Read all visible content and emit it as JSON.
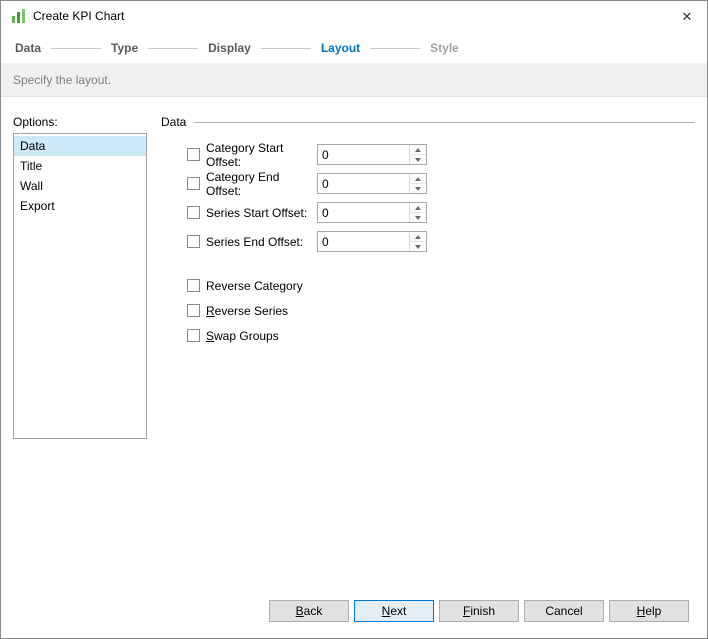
{
  "window": {
    "title": "Create KPI Chart",
    "close_glyph": "✕"
  },
  "steps": [
    {
      "label": "Data",
      "state": "done"
    },
    {
      "label": "Type",
      "state": "done"
    },
    {
      "label": "Display",
      "state": "done"
    },
    {
      "label": "Layout",
      "state": "active"
    },
    {
      "label": "Style",
      "state": "upcoming"
    }
  ],
  "subtitle": "Specify the layout.",
  "options": {
    "label": "Options:",
    "items": [
      {
        "label": "Data",
        "selected": true
      },
      {
        "label": "Title",
        "selected": false
      },
      {
        "label": "Wall",
        "selected": false
      },
      {
        "label": "Export",
        "selected": false
      }
    ]
  },
  "panel": {
    "header": "Data",
    "offset_fields": [
      {
        "label": "Category Start Offset:",
        "value": "0",
        "checked": false
      },
      {
        "label": "Category End Offset:",
        "value": "0",
        "checked": false
      },
      {
        "label": "Series Start Offset:",
        "value": "0",
        "checked": false
      },
      {
        "label": "Series End Offset:",
        "value": "0",
        "checked": false
      }
    ],
    "toggles": [
      {
        "label": "Reverse Category",
        "mnemonic": -1,
        "checked": false
      },
      {
        "label": "Reverse Series",
        "mnemonic": 0,
        "checked": false
      },
      {
        "label": "Swap Groups",
        "mnemonic": 0,
        "checked": false
      }
    ]
  },
  "footer": {
    "buttons": [
      {
        "label": "Back",
        "mnemonic": 0,
        "default": false
      },
      {
        "label": "Next",
        "mnemonic": 0,
        "default": true
      },
      {
        "label": "Finish",
        "mnemonic": 0,
        "default": false
      },
      {
        "label": "Cancel",
        "mnemonic": -1,
        "default": false
      },
      {
        "label": "Help",
        "mnemonic": 0,
        "default": false
      }
    ]
  },
  "colors": {
    "accent": "#0072c6",
    "step_done": "#595959",
    "step_upcoming": "#a3a3a3",
    "selected_item_bg": "#cde8f6",
    "band_bg": "#f0f0f0",
    "band_text": "#7f7f7f",
    "button_bg": "#e1e1e1",
    "default_button_border": "#0078d7",
    "icon_green": "#3f9c35"
  }
}
